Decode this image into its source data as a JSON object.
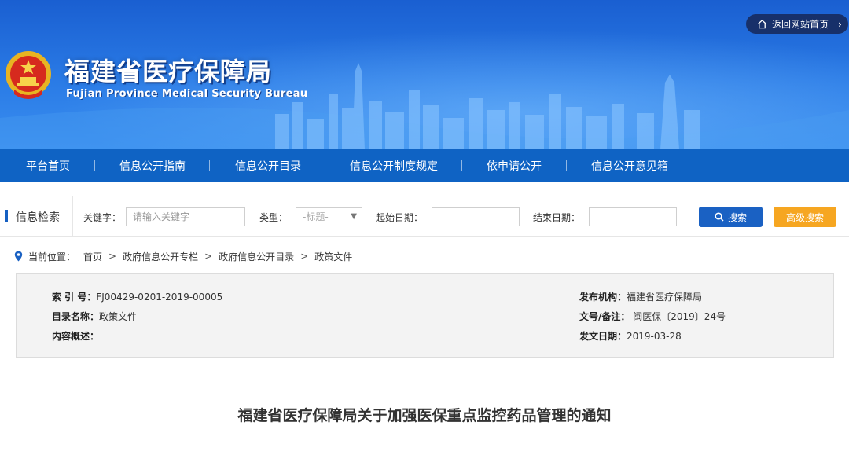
{
  "header": {
    "title": "福建省医疗保障局",
    "subtitle": "Fujian Province Medical Security Bureau",
    "return_home": "返回网站首页",
    "emblem_icon": "national-emblem-icon"
  },
  "nav": {
    "items": [
      {
        "label": "平台首页"
      },
      {
        "label": "信息公开指南"
      },
      {
        "label": "信息公开目录"
      },
      {
        "label": "信息公开制度规定"
      },
      {
        "label": "依申请公开"
      },
      {
        "label": "信息公开意见箱"
      }
    ]
  },
  "search": {
    "section_label": "信息检索",
    "keyword_label": "关键字：",
    "keyword_placeholder": "请输入关键字",
    "type_label": "类型：",
    "type_value": "-标题-",
    "start_date_label": "起始日期：",
    "end_date_label": "结束日期：",
    "search_button": "搜索",
    "advanced_button": "高级搜索"
  },
  "breadcrumb": {
    "prefix": "当前位置：",
    "items": [
      "首页",
      "政府信息公开专栏",
      "政府信息公开目录",
      "政策文件"
    ]
  },
  "info": {
    "index_key": "索 引 号：",
    "index_value": "FJ00429-0201-2019-00005",
    "catalog_key": "目录名称：",
    "catalog_value": "政策文件",
    "summary_key": "内容概述：",
    "summary_value": "",
    "publisher_key": "发布机构：",
    "publisher_value": "福建省医疗保障局",
    "docno_key": "文号/备注：",
    "docno_value": " 闽医保〔2019〕24号",
    "date_key": "发文日期：",
    "date_value": "2019-03-28"
  },
  "document": {
    "title": "福建省医疗保障局关于加强医保重点监控药品管理的通知"
  },
  "colors": {
    "nav_bg": "#0f63c4",
    "search_button": "#1a61c3",
    "advanced_button": "#f6a621",
    "return_home_bg": "#17306a"
  }
}
